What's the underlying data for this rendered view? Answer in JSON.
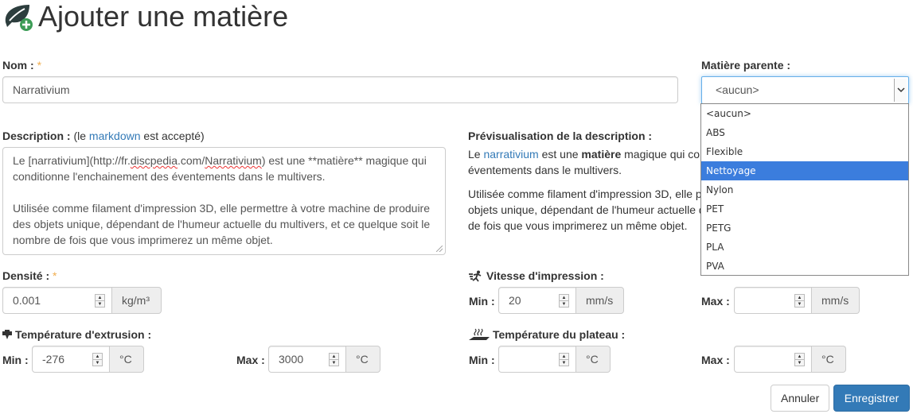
{
  "page": {
    "title": "Ajouter une matière",
    "logo_icon": "leaf-plus-icon"
  },
  "name": {
    "label": "Nom :",
    "required_mark": "*",
    "value": "Narrativium"
  },
  "parent": {
    "label": "Matière parente :",
    "selected": "<aucun>",
    "options": [
      "<aucun>",
      "ABS",
      "Flexible",
      "Nettoyage",
      "Nylon",
      "PET",
      "PETG",
      "PLA",
      "PVA"
    ],
    "highlighted": "Nettoyage"
  },
  "description": {
    "label": "Description :",
    "hint_prefix": "(le ",
    "hint_link": "markdown",
    "hint_suffix": " est accepté)",
    "text_line1_a": "Le [narrativium](http://fr.",
    "text_line1_b": "discpedia",
    "text_line1_c": ".com/",
    "text_line1_d": "Narrativium",
    "text_line1_e": ") est une **matière** magique qui conditionne l'enchainement des éventements dans le multivers.",
    "text_para2": "Utilisée comme filament d'impression 3D, elle permettre à votre machine de produire des objets unique, dépendant de l'humeur actuelle du multivers, et ce quelque soit le nombre de fois que vous imprimerez un même objet."
  },
  "preview": {
    "label": "Prévisualisation de la description :",
    "p1_start": "Le ",
    "p1_link": "narrativium",
    "p1_mid": " est une ",
    "p1_bold": "matière",
    "p1_end": " magique qui conditionne l'enchainement des éventements dans le multivers.",
    "p2": "Utilisée comme filament d'impression 3D, elle permettre à votre machine de produire des objets unique, dépendant de l'humeur actuelle du multivers, et ce quelque soit le nombre de fois que vous imprimerez un même objet."
  },
  "density": {
    "label": "Densité :",
    "required_mark": "*",
    "value": "0.001",
    "unit": "kg/m³"
  },
  "speed": {
    "label": "Vitesse d'impression :",
    "icon": "running-icon",
    "min_label": "Min :",
    "min_value": "20",
    "max_label": "Max :",
    "max_value": "",
    "unit": "mm/s"
  },
  "extrusion": {
    "label": "Température d'extrusion :",
    "icon": "nozzle-icon",
    "min_label": "Min :",
    "min_value": "-276",
    "max_label": "Max :",
    "max_value": "3000",
    "unit": "°C"
  },
  "bed": {
    "label": "Température du plateau :",
    "icon": "heated-bed-icon",
    "min_label": "Min :",
    "min_value": "",
    "max_label": "Max :",
    "max_value": "",
    "unit": "°C"
  },
  "buttons": {
    "cancel": "Annuler",
    "save": "Enregistrer"
  }
}
